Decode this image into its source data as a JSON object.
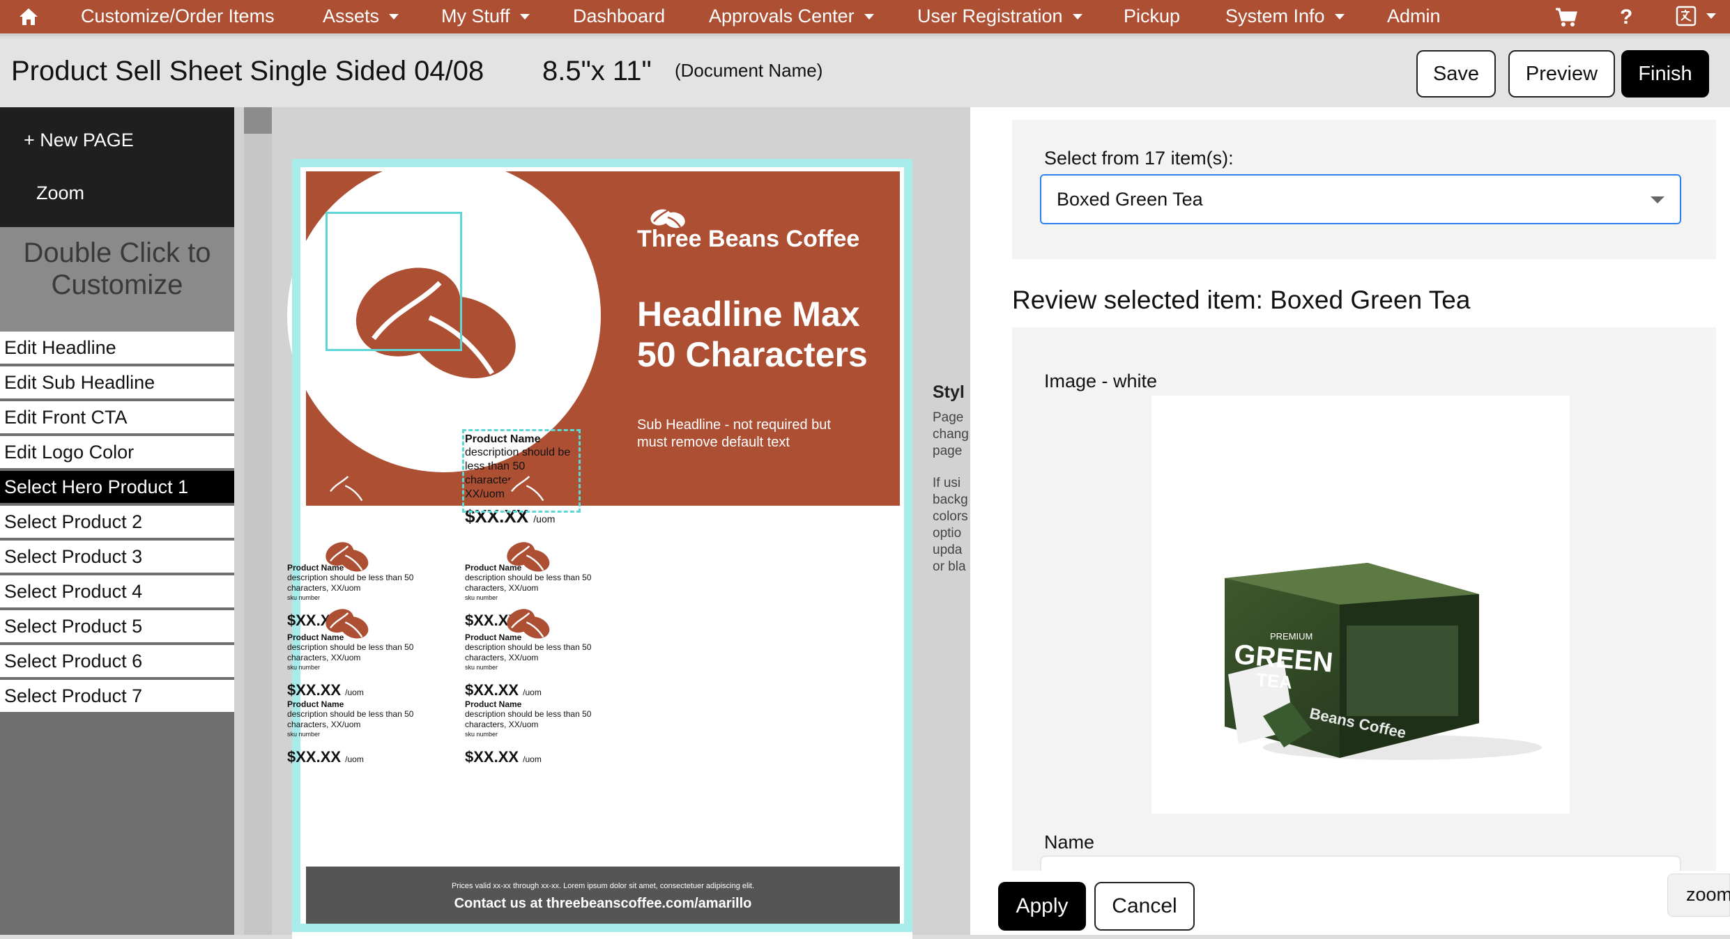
{
  "nav": {
    "items": [
      {
        "label": "Customize/Order Items",
        "dropdown": false
      },
      {
        "label": "Assets",
        "dropdown": true
      },
      {
        "label": "My Stuff",
        "dropdown": true
      },
      {
        "label": "Dashboard",
        "dropdown": false
      },
      {
        "label": "Approvals Center",
        "dropdown": true
      },
      {
        "label": "User Registration",
        "dropdown": true
      },
      {
        "label": "Pickup",
        "dropdown": false
      },
      {
        "label": "System Info",
        "dropdown": true
      },
      {
        "label": "Admin",
        "dropdown": false
      }
    ],
    "help_label": "?",
    "icons": [
      "home-icon",
      "cart-icon",
      "help-icon",
      "language-icon"
    ]
  },
  "titlebar": {
    "title": "Product Sell Sheet Single Sided 04/08",
    "size": "8.5\"x 11\"",
    "doc_name": "(Document Name)",
    "save_label": "Save",
    "preview_label": "Preview",
    "finish_label": "Finish"
  },
  "sidebar": {
    "new_page": "+ New PAGE",
    "zoom": "Zoom",
    "double_click": "Double Click to Customize",
    "menu": [
      "Edit Headline",
      "Edit Sub Headline",
      "Edit Front CTA",
      "Edit Logo Color",
      "Select Hero Product 1",
      "Select Product 2",
      "Select Product 3",
      "Select Product 4",
      "Select Product 5",
      "Select Product 6",
      "Select Product 7"
    ],
    "active_index": 4
  },
  "document": {
    "brand": "Three Beans Coffee",
    "headline": "Headline Max 50 Characters",
    "subheadline": "Sub Headline - not required but must remove default text",
    "hero_product": {
      "name": "Product Name",
      "desc": "description should be less than 50 characters",
      "uom": "XX/uom",
      "price": "$XX.XX",
      "price_unit": "/uom"
    },
    "product": {
      "name": "Product Name",
      "desc": "description should be less than 50 characters, XX/uom",
      "sku": "sku number",
      "price": "$XX.XX",
      "price_unit": "/uom"
    },
    "footer_small": "Prices valid xx-xx through xx-xx. Lorem ipsum dolor sit amet, consectetuer adipiscing elit.",
    "footer_contact": "Contact us at threebeanscoffee.com/amarillo",
    "style_peek": {
      "heading": "Styl",
      "lines1": [
        "Page",
        "chang",
        "page"
      ],
      "lines2": [
        "If usi",
        "backg",
        "colors",
        "optio",
        "upda",
        "or bla"
      ]
    },
    "colors": {
      "brand": "#ad4f33",
      "guide": "#a7ecea",
      "footer": "#555555"
    }
  },
  "panel": {
    "select_label": "Select from 17 item(s):",
    "selected_value": "Boxed Green Tea",
    "review_title": "Review selected item: Boxed Green Tea",
    "image_label": "Image - white",
    "name_label": "Name",
    "apply_label": "Apply",
    "cancel_label": "Cancel",
    "zoom_label": "zoom",
    "product_box": {
      "small": "PREMIUM",
      "big1": "GREEN",
      "big2": "TEA",
      "brand": "Beans Coffee"
    }
  }
}
